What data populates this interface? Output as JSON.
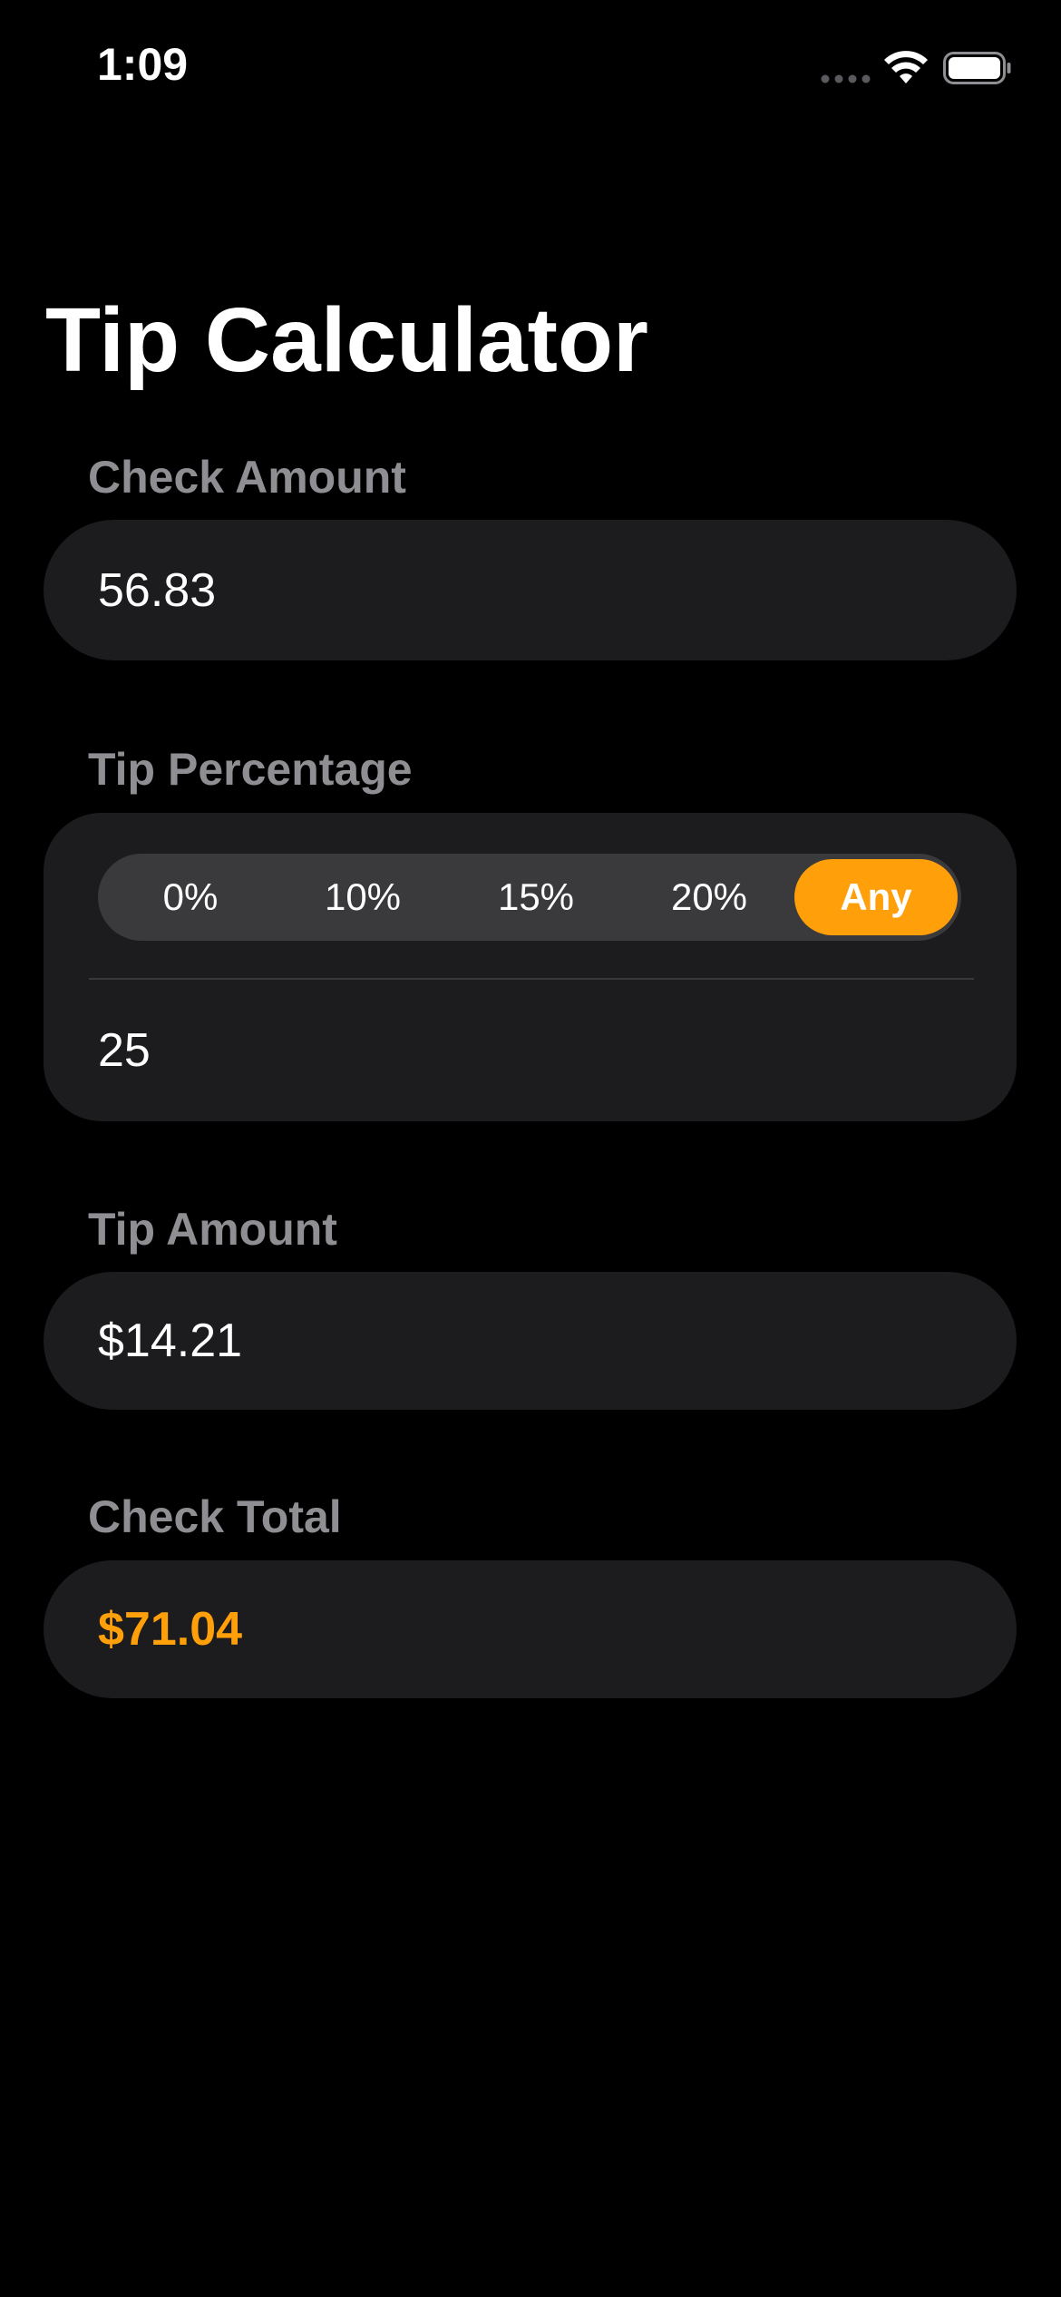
{
  "status_bar": {
    "time": "1:09",
    "icons": [
      "cellular-signal-icon",
      "wifi-icon",
      "battery-icon"
    ]
  },
  "title": "Tip Calculator",
  "check_amount": {
    "label": "Check Amount",
    "value": "56.83"
  },
  "tip_percentage": {
    "label": "Tip Percentage",
    "options": [
      "0%",
      "10%",
      "15%",
      "20%",
      "Any"
    ],
    "selected": "Any",
    "custom_value": "25"
  },
  "tip_amount": {
    "label": "Tip Amount",
    "value": "$14.21"
  },
  "check_total": {
    "label": "Check Total",
    "value": "$71.04"
  },
  "colors": {
    "accent": "#ff9f0a",
    "background": "#000000",
    "card": "#1c1c1e",
    "segment_bg": "#3a3a3c",
    "label": "#8e8e93"
  }
}
